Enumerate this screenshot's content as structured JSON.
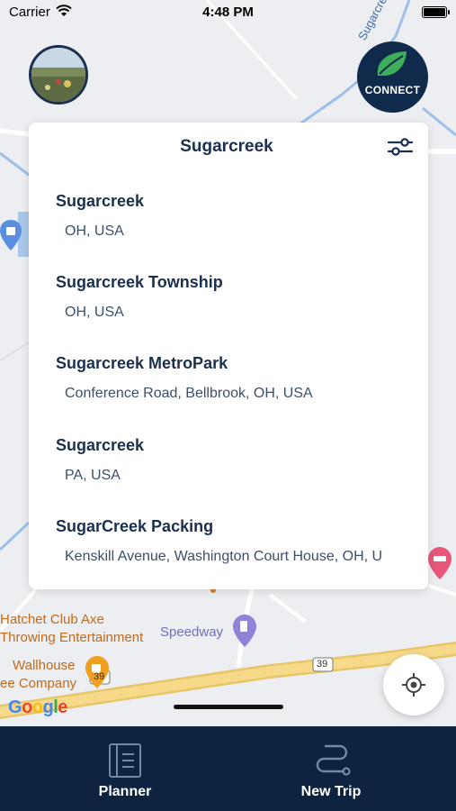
{
  "status_bar": {
    "carrier": "Carrier",
    "time": "4:48 PM"
  },
  "map": {
    "road_label_top": "Sugarcreek",
    "route_shield_39": "39",
    "poi_labels": {
      "hatchet_line1": "Hatchet Club Axe",
      "hatchet_line2": "Throwing Entertainment",
      "speedway": "Speedway",
      "wallhouse_line1": "Wallhouse",
      "wallhouse_line2": "ee Company"
    },
    "google_logo": "Google"
  },
  "connect_button": {
    "label": "CONNECT",
    "color": "#102a4c"
  },
  "search": {
    "value": "Sugarcreek",
    "placeholder": ""
  },
  "results": [
    {
      "name": "Sugarcreek",
      "address": "OH, USA"
    },
    {
      "name": "Sugarcreek Township",
      "address": "OH, USA"
    },
    {
      "name": "Sugarcreek MetroPark",
      "address": "Conference Road, Bellbrook, OH, USA"
    },
    {
      "name": "Sugarcreek",
      "address": "PA, USA"
    },
    {
      "name": "SugarCreek Packing",
      "address": "Kenskill Avenue, Washington Court House, OH, U"
    }
  ],
  "bottom_nav": {
    "items": [
      {
        "label": "Planner",
        "icon": "planner-notebook-icon"
      },
      {
        "label": "New Trip",
        "icon": "route-path-icon"
      }
    ],
    "background": "#0d2340"
  },
  "colors": {
    "accent": "#1b2f4f",
    "road_yellow": "#f3d27a",
    "water_blue": "#a9c7ea"
  }
}
